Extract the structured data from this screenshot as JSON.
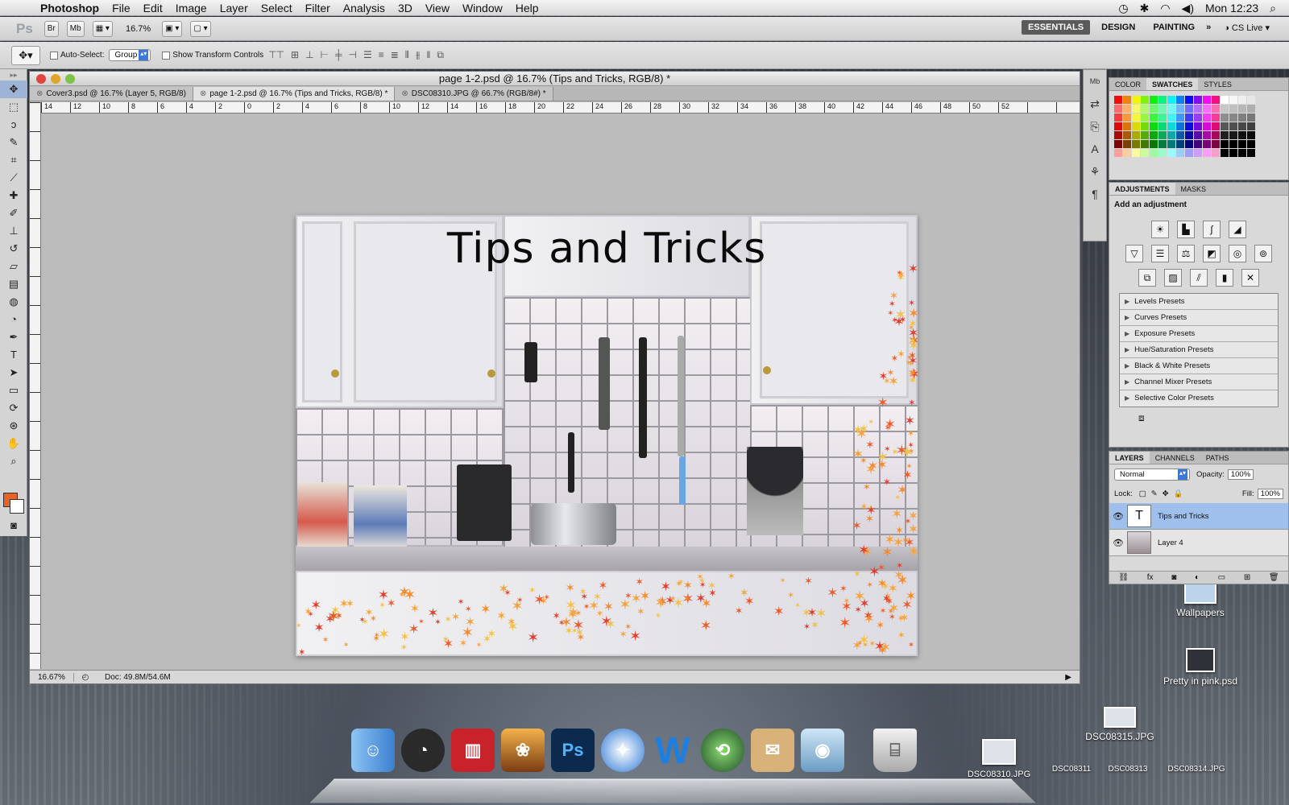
{
  "menubar": {
    "app_name": "Photoshop",
    "items": [
      "File",
      "Edit",
      "Image",
      "Layer",
      "Select",
      "Filter",
      "Analysis",
      "3D",
      "View",
      "Window",
      "Help"
    ],
    "clock": "Mon 12:23"
  },
  "appbar": {
    "logo": "Ps",
    "bridge_label": "Br",
    "minibridge_label": "Mb",
    "zoom": "16.7%",
    "workspaces": [
      "ESSENTIALS",
      "DESIGN",
      "PAINTING"
    ],
    "active_workspace": "ESSENTIALS",
    "cs_live": "CS Live"
  },
  "options": {
    "auto_select_label": "Auto-Select:",
    "auto_select_value": "Group",
    "transform_label": "Show Transform Controls"
  },
  "document": {
    "window_title": "page 1-2.psd @ 16.7% (Tips and Tricks, RGB/8) *",
    "tabs": [
      {
        "label": "Cover3.psd @ 16.7% (Layer 5, RGB/8)",
        "active": false
      },
      {
        "label": "page 1-2.psd @ 16.7% (Tips and Tricks, RGB/8) *",
        "active": true
      },
      {
        "label": "DSC08310.JPG @ 66.7% (RGB/8#) *",
        "active": false
      }
    ],
    "ruler_labels": [
      "14",
      "12",
      "10",
      "8",
      "6",
      "4",
      "2",
      "0",
      "2",
      "4",
      "6",
      "8",
      "10",
      "12",
      "14",
      "16",
      "18",
      "20",
      "22",
      "24",
      "26",
      "28",
      "30",
      "32",
      "34",
      "36",
      "38",
      "40",
      "42",
      "44",
      "46",
      "48",
      "50",
      "52"
    ],
    "art_title": "Tips and Tricks",
    "status_zoom": "16.67%",
    "status_doc": "Doc: 49.8M/54.6M"
  },
  "panels": {
    "color_tabs": [
      "COLOR",
      "SWATCHES",
      "STYLES"
    ],
    "active_color_tab": "SWATCHES",
    "adjust_tabs": [
      "ADJUSTMENTS",
      "MASKS"
    ],
    "adjust_title": "Add an adjustment",
    "presets": [
      "Levels Presets",
      "Curves Presets",
      "Exposure Presets",
      "Hue/Saturation Presets",
      "Black & White Presets",
      "Channel Mixer Presets",
      "Selective Color Presets"
    ],
    "layers_tabs": [
      "LAYERS",
      "CHANNELS",
      "PATHS"
    ],
    "blend_mode": "Normal",
    "opacity_label": "Opacity:",
    "opacity_value": "100%",
    "lock_label": "Lock:",
    "fill_label": "Fill:",
    "fill_value": "100%",
    "layers": [
      {
        "name": "Tips and Tricks",
        "selected": true
      },
      {
        "name": "Layer 4",
        "selected": false
      }
    ]
  },
  "desktop": {
    "items": [
      "Wallpapers",
      "Pretty in pink.psd",
      "DSC08315.JPG"
    ],
    "bottom_labels": [
      "DSC08310.JPG",
      "DSC08311",
      "DSC08313",
      "DSC08314.JPG"
    ]
  },
  "dock": {
    "apps": [
      "finder",
      "dashboard",
      "photo-booth",
      "iphoto",
      "photoshop",
      "safari",
      "word",
      "time-machine",
      "preview",
      "iphoto-2",
      "trash"
    ]
  },
  "colors": {
    "foreground": "#e8632a",
    "selection": "#9fc0ec",
    "accent": "#3b78d8"
  }
}
